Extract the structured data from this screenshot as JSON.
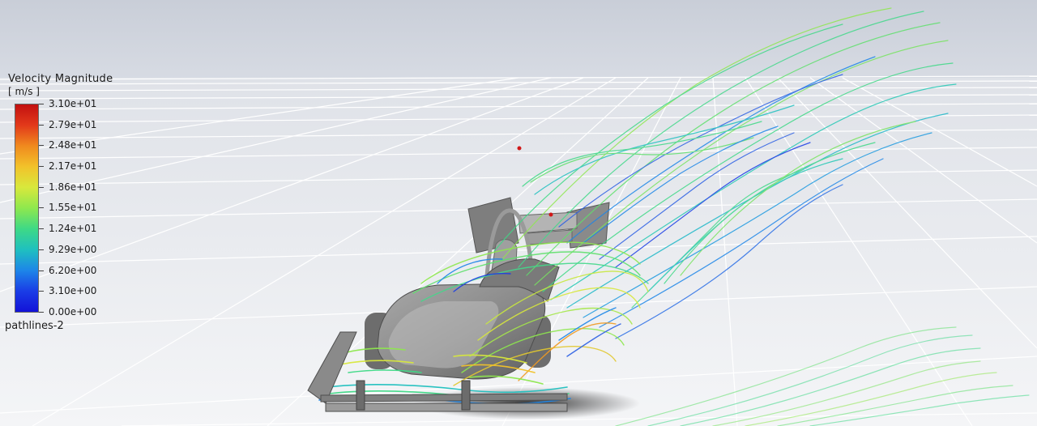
{
  "legend": {
    "title": "Velocity Magnitude",
    "units": "[ m/s ]",
    "ticks": [
      "3.10e+01",
      "2.79e+01",
      "2.48e+01",
      "2.17e+01",
      "1.86e+01",
      "1.55e+01",
      "1.24e+01",
      "9.29e+00",
      "6.20e+00",
      "3.10e+00",
      "0.00e+00"
    ],
    "colors": [
      "#c21010",
      "#e2391a",
      "#f08a1e",
      "#f2c22a",
      "#d8e83c",
      "#8ee84e",
      "#3ed986",
      "#1fc0bf",
      "#1d86e8",
      "#1a3de6",
      "#1212d8"
    ]
  },
  "caption": "pathlines-2",
  "scene": {
    "background_top": "#c9ced8",
    "background_bottom": "#f3f4f6",
    "grid_color": "#ffffff",
    "car_body": "#8c8c8c",
    "probe_color": "#d01818"
  }
}
